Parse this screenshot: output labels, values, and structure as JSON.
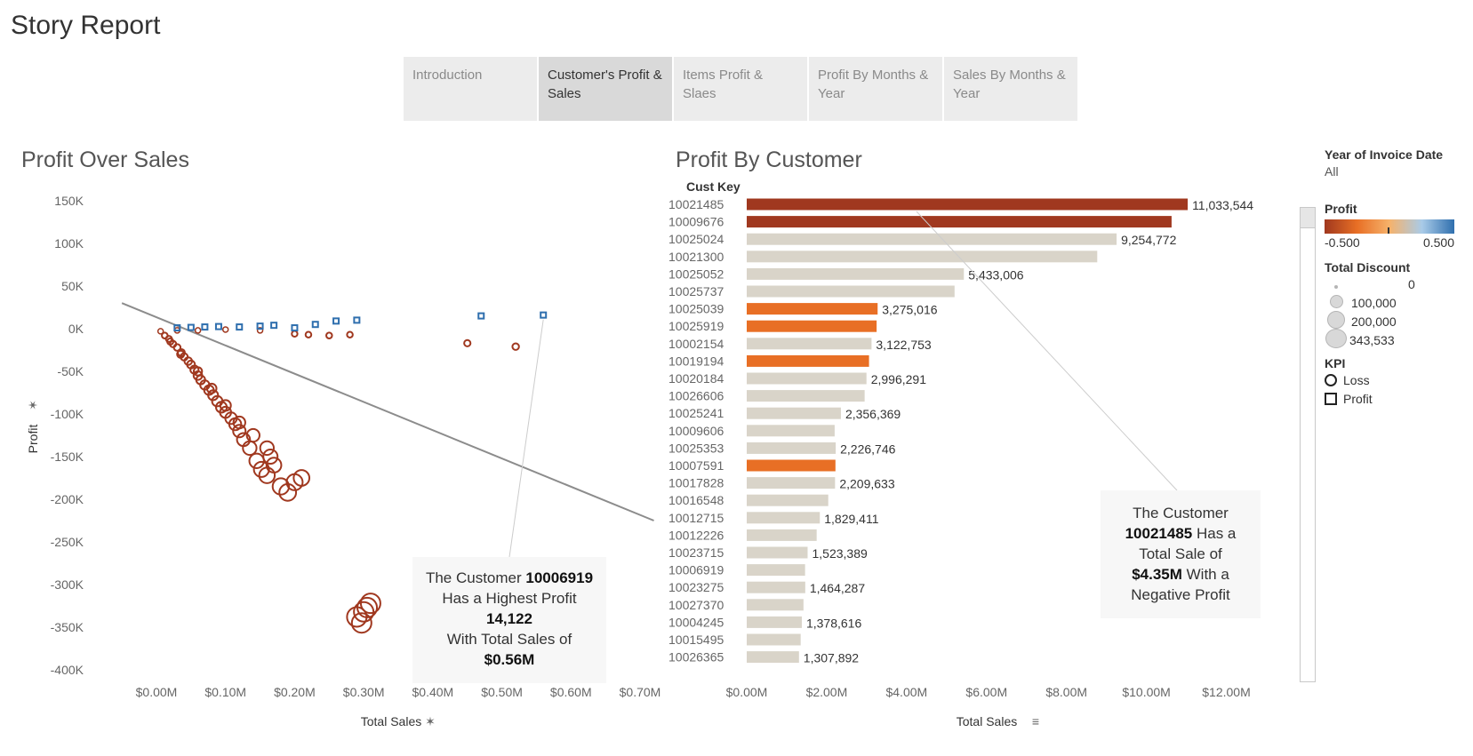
{
  "page": {
    "title": "Story Report"
  },
  "story_tabs": [
    {
      "label": "Introduction",
      "active": false
    },
    {
      "label": "Customer's Profit & Sales",
      "active": true
    },
    {
      "label": "Items Profit & Slaes",
      "active": false
    },
    {
      "label": "Profit By Months & Year",
      "active": false
    },
    {
      "label": "Sales By Months & Year",
      "active": false
    }
  ],
  "colors": {
    "loss": "#a0381f",
    "profit": "#2f6fae",
    "neutral": "#d9d4c9",
    "orange": "#e86f25",
    "text": "#333333"
  },
  "annotations": {
    "scatter": {
      "line1": "The Customer",
      "id": "10006919",
      "line2": "Has a Highest Profit",
      "value": "14,122",
      "line3": "With Total Sales of",
      "sales": "$0.56M"
    },
    "bar": {
      "line1": "The Customer",
      "id": "10021485",
      "line2": "Has a",
      "line3": "Total Sale of",
      "sales": "$4.35M",
      "line4": "With a",
      "line5": "Negative Profit"
    }
  },
  "legend": {
    "year": {
      "title": "Year of Invoice Date",
      "value": "All"
    },
    "profit": {
      "title": "Profit",
      "min": "-0.500",
      "max": "0.500"
    },
    "discount": {
      "title": "Total Discount",
      "items": [
        "0",
        "100,000",
        "200,000",
        "343,533"
      ]
    },
    "kpi": {
      "title": "KPI",
      "items": [
        "Loss",
        "Profit"
      ]
    }
  },
  "chart_data": [
    {
      "type": "scatter",
      "title": "Profit Over Sales",
      "xlabel": "Total Sales",
      "ylabel": "Profit",
      "xlim": [
        0,
        0.7
      ],
      "ylim": [
        -400000,
        150000
      ],
      "x_ticks": [
        "$0.00M",
        "$0.10M",
        "$0.20M",
        "$0.30M",
        "$0.40M",
        "$0.50M",
        "$0.60M",
        "$0.70M"
      ],
      "x_tick_values": [
        0,
        0.1,
        0.2,
        0.3,
        0.4,
        0.5,
        0.6,
        0.7
      ],
      "y_ticks": [
        "150K",
        "100K",
        "50K",
        "0K",
        "-50K",
        "-100K",
        "-150K",
        "-200K",
        "-250K",
        "-300K",
        "-350K",
        "-400K"
      ],
      "y_tick_values": [
        150000,
        100000,
        50000,
        0,
        -50000,
        -100000,
        -150000,
        -200000,
        -250000,
        -300000,
        -350000,
        -400000
      ],
      "trend_line": {
        "x": [
          -0.05,
          0.72
        ],
        "y": [
          30000,
          -225000
        ]
      },
      "series": [
        {
          "kpi": "Loss",
          "points": [
            [
              0.006,
              -3000
            ],
            [
              0.012,
              -8000
            ],
            [
              0.018,
              -12000
            ],
            [
              0.024,
              -18000
            ],
            [
              0.03,
              -22000
            ],
            [
              0.036,
              -28000
            ],
            [
              0.04,
              -33000
            ],
            [
              0.046,
              -38000
            ],
            [
              0.05,
              -42000
            ],
            [
              0.055,
              -48000
            ],
            [
              0.06,
              -55000
            ],
            [
              0.064,
              -60000
            ],
            [
              0.07,
              -66000
            ],
            [
              0.076,
              -72000
            ],
            [
              0.082,
              -78000
            ],
            [
              0.088,
              -85000
            ],
            [
              0.094,
              -92000
            ],
            [
              0.1,
              -98000
            ],
            [
              0.108,
              -105000
            ],
            [
              0.114,
              -112000
            ],
            [
              0.12,
              -120000
            ],
            [
              0.126,
              -130000
            ],
            [
              0.135,
              -140000
            ],
            [
              0.145,
              -155000
            ],
            [
              0.152,
              -165000
            ],
            [
              0.16,
              -172000
            ],
            [
              0.165,
              -150000
            ],
            [
              0.17,
              -160000
            ],
            [
              0.18,
              -185000
            ],
            [
              0.19,
              -192000
            ],
            [
              0.2,
              -180000
            ],
            [
              0.21,
              -175000
            ],
            [
              0.02,
              -15000
            ],
            [
              0.035,
              -30000
            ],
            [
              0.06,
              -50000
            ],
            [
              0.08,
              -70000
            ],
            [
              0.1,
              -90000
            ],
            [
              0.12,
              -110000
            ],
            [
              0.14,
              -125000
            ],
            [
              0.16,
              -140000
            ],
            [
              0.29,
              -338000
            ],
            [
              0.3,
              -332000
            ],
            [
              0.305,
              -327000
            ],
            [
              0.31,
              -322000
            ],
            [
              0.297,
              -345000
            ],
            [
              0.03,
              -2000
            ],
            [
              0.06,
              -2000
            ],
            [
              0.1,
              -1000
            ],
            [
              0.15,
              -2000
            ],
            [
              0.2,
              -6000
            ],
            [
              0.22,
              -7000
            ],
            [
              0.25,
              -8000
            ],
            [
              0.28,
              -7000
            ],
            [
              0.45,
              -17000
            ],
            [
              0.52,
              -21000
            ]
          ]
        },
        {
          "kpi": "Profit",
          "points": [
            [
              0.03,
              1000
            ],
            [
              0.05,
              1500
            ],
            [
              0.07,
              2000
            ],
            [
              0.09,
              2500
            ],
            [
              0.12,
              2000
            ],
            [
              0.15,
              3000
            ],
            [
              0.17,
              4000
            ],
            [
              0.2,
              1000
            ],
            [
              0.23,
              5000
            ],
            [
              0.26,
              9000
            ],
            [
              0.29,
              10000
            ],
            [
              0.47,
              15000
            ],
            [
              0.56,
              16000
            ]
          ]
        }
      ]
    },
    {
      "type": "bar",
      "orientation": "horizontal",
      "title": "Profit By Customer",
      "category_header": "Cust Key",
      "xlabel": "Total Sales",
      "xlim": [
        0,
        12500000
      ],
      "x_ticks": [
        "$0.00M",
        "$2.00M",
        "$4.00M",
        "$6.00M",
        "$8.00M",
        "$10.00M",
        "$12.00M"
      ],
      "x_tick_values": [
        0,
        2000000,
        4000000,
        6000000,
        8000000,
        10000000,
        12000000
      ],
      "categories": [
        "10021485",
        "10009676",
        "10025024",
        "10021300",
        "10025052",
        "10025737",
        "10025039",
        "10025919",
        "10002154",
        "10019194",
        "10020184",
        "10026606",
        "10025241",
        "10009606",
        "10025353",
        "10007591",
        "10017828",
        "10016548",
        "10012715",
        "10012226",
        "10023715",
        "10006919",
        "10023275",
        "10027370",
        "10004245",
        "10015495",
        "10026365"
      ],
      "values": [
        11033544,
        10630000,
        9254772,
        8770000,
        5433006,
        5200000,
        3275016,
        3250000,
        3122753,
        3060000,
        2996291,
        2950000,
        2356369,
        2200000,
        2226746,
        2220000,
        2209633,
        2040000,
        1829411,
        1750000,
        1523389,
        1460000,
        1464287,
        1420000,
        1378616,
        1350000,
        1307892
      ],
      "labels": [
        "11,033,544",
        "",
        "9,254,772",
        "",
        "5,433,006",
        "",
        "3,275,016",
        "",
        "3,122,753",
        "",
        "2,996,291",
        "",
        "2,356,369",
        "",
        "2,226,746",
        "",
        "2,209,633",
        "",
        "1,829,411",
        "",
        "1,523,389",
        "",
        "1,464,287",
        "",
        "1,378,616",
        "",
        "1,307,892"
      ],
      "color_key": [
        "loss",
        "loss",
        "neutral",
        "neutral",
        "neutral",
        "neutral",
        "orange",
        "orange",
        "neutral",
        "orange",
        "neutral",
        "neutral",
        "neutral",
        "neutral",
        "neutral",
        "orange",
        "neutral",
        "neutral",
        "neutral",
        "neutral",
        "neutral",
        "neutral",
        "neutral",
        "neutral",
        "neutral",
        "neutral",
        "neutral"
      ]
    }
  ]
}
